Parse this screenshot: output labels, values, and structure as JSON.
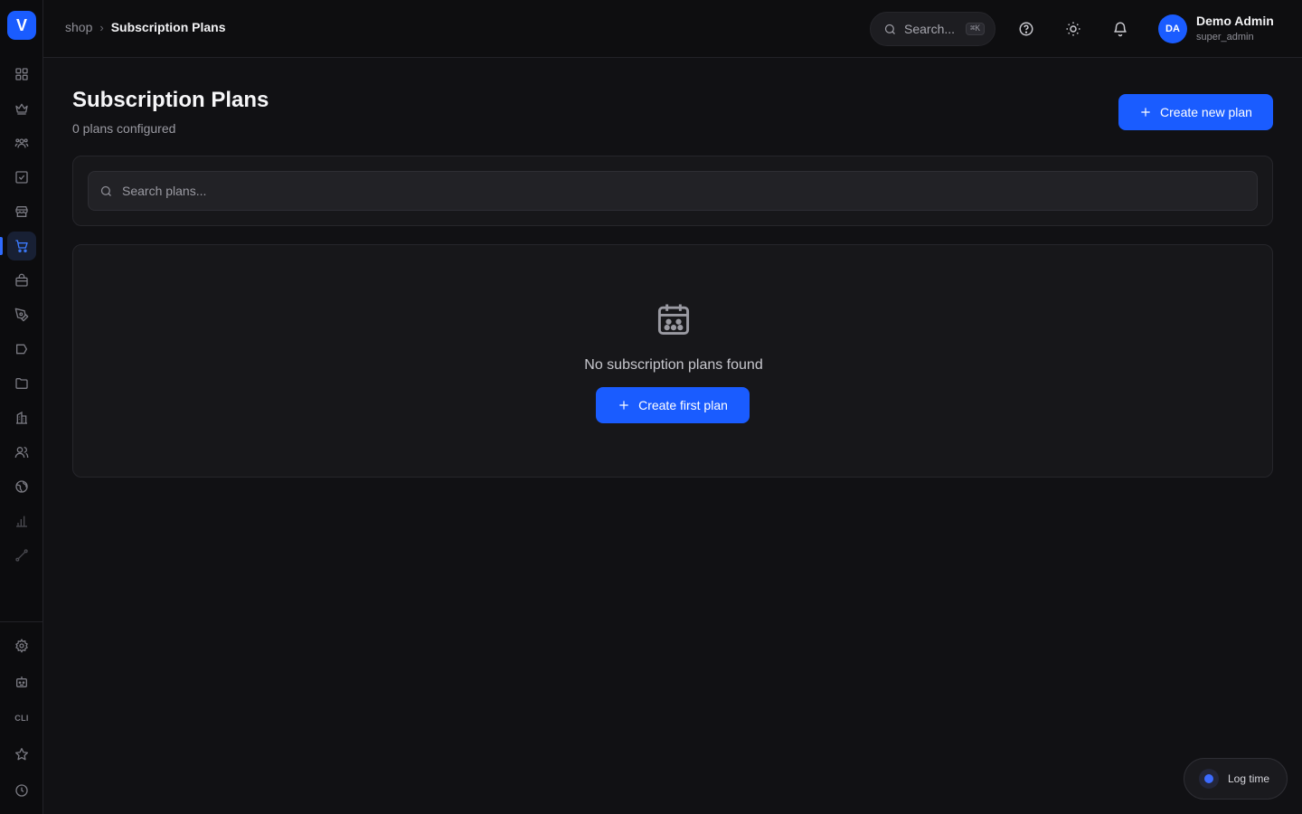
{
  "app": {
    "logo_letter": "V"
  },
  "sidebar": {
    "items": [
      {
        "name": "dashboard",
        "icon": "grid-icon"
      },
      {
        "name": "crown",
        "icon": "crown-icon"
      },
      {
        "name": "teams",
        "icon": "users-icon"
      },
      {
        "name": "tasks",
        "icon": "checkbox-icon"
      },
      {
        "name": "store",
        "icon": "store-icon"
      },
      {
        "name": "shop",
        "icon": "cart-icon",
        "active": true
      },
      {
        "name": "products",
        "icon": "bag-icon"
      },
      {
        "name": "design",
        "icon": "pen-icon"
      },
      {
        "name": "campaigns",
        "icon": "megaphone-icon"
      },
      {
        "name": "files",
        "icon": "folder-icon"
      },
      {
        "name": "company",
        "icon": "building-icon"
      },
      {
        "name": "members",
        "icon": "people-icon"
      },
      {
        "name": "global",
        "icon": "globe-icon"
      },
      {
        "name": "analytics",
        "icon": "bar-chart-icon"
      },
      {
        "name": "routes",
        "icon": "route-icon"
      }
    ],
    "bottom": {
      "settings": "gear-icon",
      "bot": "bot-icon",
      "cli_label": "CLI",
      "favorites": "star-icon",
      "history": "clock-icon"
    }
  },
  "topbar": {
    "breadcrumb": {
      "parent": "shop",
      "current": "Subscription Plans"
    },
    "search": {
      "label": "Search...",
      "shortcut": "⌘K"
    },
    "user": {
      "initials": "DA",
      "name": "Demo Admin",
      "role": "super_admin"
    }
  },
  "page": {
    "title": "Subscription Plans",
    "subtitle": "0 plans configured",
    "create_button": "Create new plan",
    "search_placeholder": "Search plans...",
    "empty_message": "No subscription plans found",
    "empty_button": "Create first plan"
  },
  "widget": {
    "log_time": "Log time"
  },
  "colors": {
    "accent": "#1a5cff",
    "background": "#111114",
    "card": "#17171a"
  }
}
